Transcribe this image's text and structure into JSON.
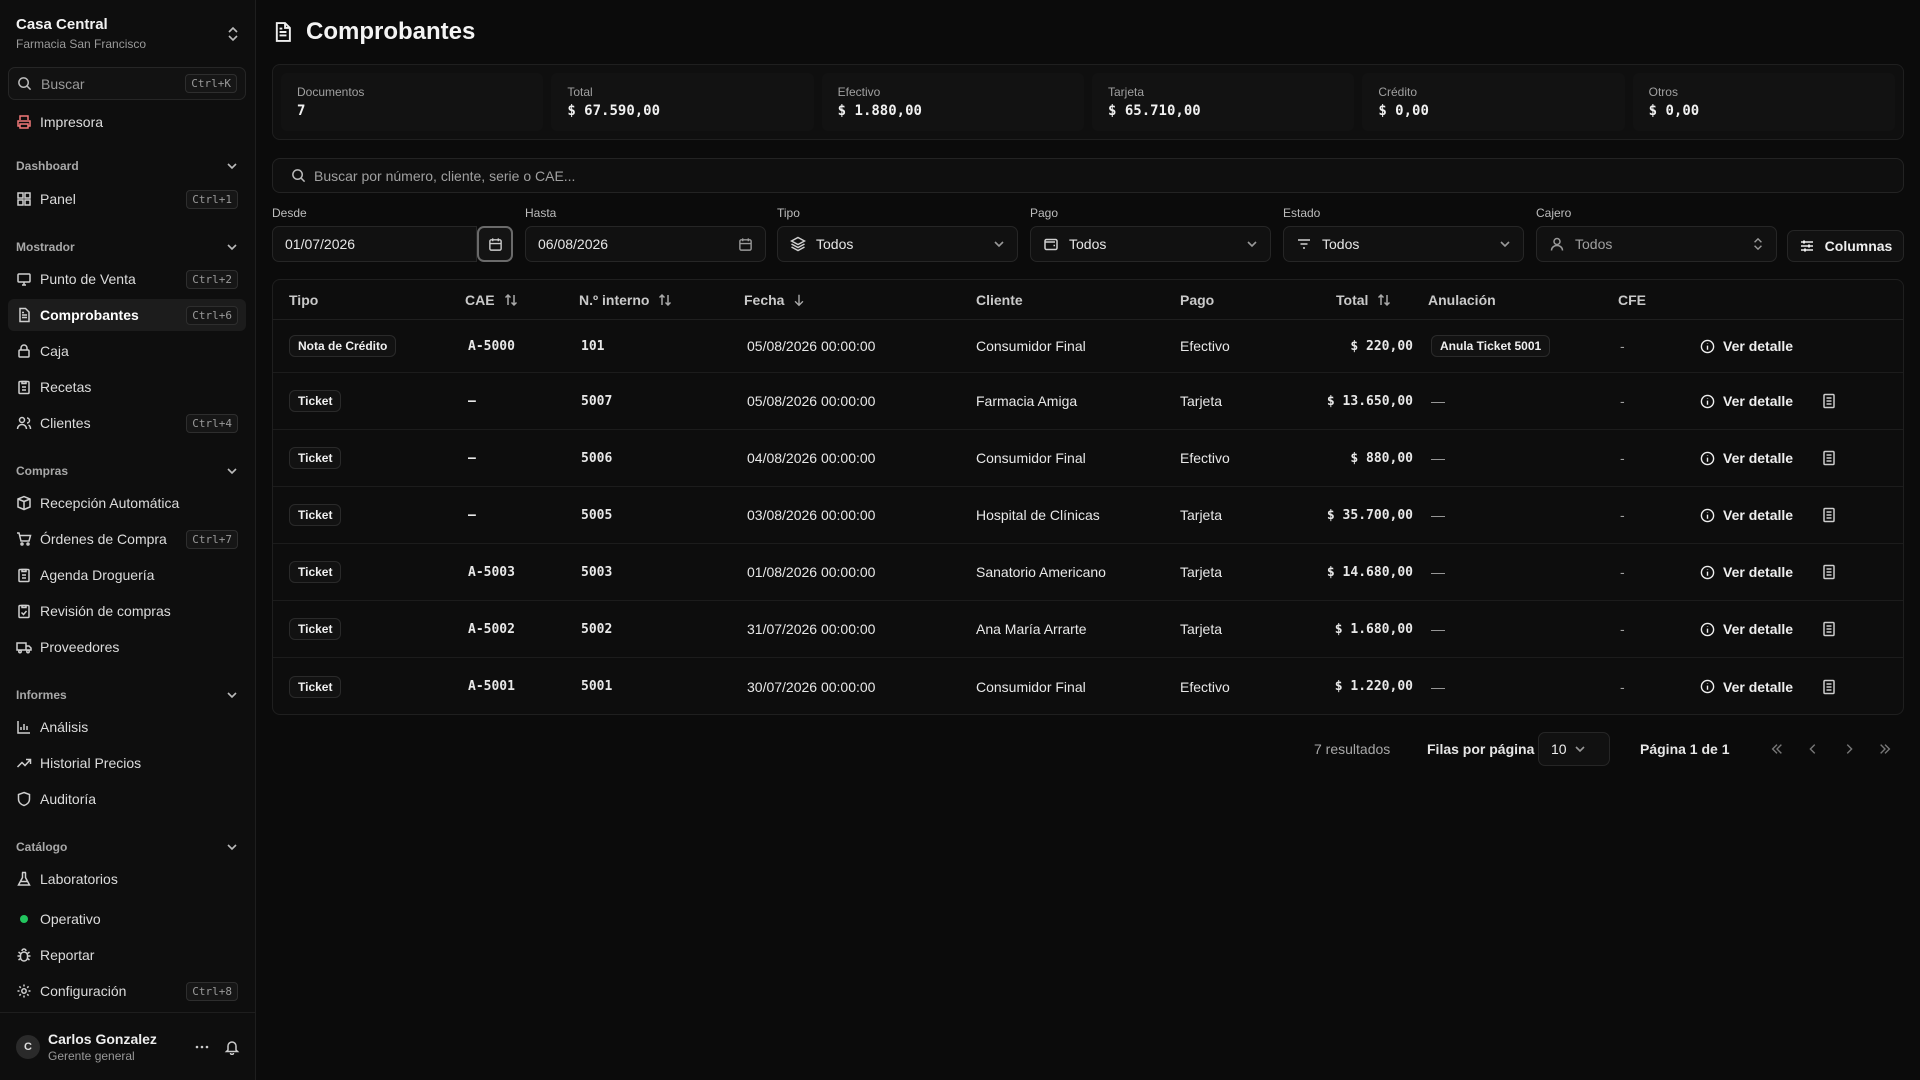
{
  "org": {
    "name": "Casa Central",
    "sub": "Farmacia San Francisco"
  },
  "sidebar": {
    "search": {
      "placeholder": "Buscar",
      "shortcut": "Ctrl+K"
    },
    "printer": "Impresora",
    "groups": {
      "dashboard": "Dashboard",
      "mostrador": "Mostrador",
      "compras": "Compras",
      "informes": "Informes",
      "catalogo": "Catálogo"
    },
    "items": {
      "panel": {
        "label": "Panel",
        "shortcut": "Ctrl+1"
      },
      "pos": {
        "label": "Punto de Venta",
        "shortcut": "Ctrl+2"
      },
      "comprobantes": {
        "label": "Comprobantes",
        "shortcut": "Ctrl+6"
      },
      "caja": {
        "label": "Caja"
      },
      "recetas": {
        "label": "Recetas"
      },
      "clientes": {
        "label": "Clientes",
        "shortcut": "Ctrl+4"
      },
      "recepcion": {
        "label": "Recepción Automática"
      },
      "ordenes": {
        "label": "Órdenes de Compra",
        "shortcut": "Ctrl+7"
      },
      "agenda": {
        "label": "Agenda Droguería"
      },
      "revision": {
        "label": "Revisión de compras"
      },
      "proveedores": {
        "label": "Proveedores"
      },
      "analisis": {
        "label": "Análisis"
      },
      "historial": {
        "label": "Historial Precios"
      },
      "auditoria": {
        "label": "Auditoría"
      },
      "laboratorios": {
        "label": "Laboratorios"
      },
      "operativo": {
        "label": "Operativo"
      },
      "reportar": {
        "label": "Reportar"
      },
      "config": {
        "label": "Configuración",
        "shortcut": "Ctrl+8"
      }
    },
    "user": {
      "initial": "C",
      "name": "Carlos Gonzalez",
      "role": "Gerente general"
    }
  },
  "page": {
    "title": "Comprobantes"
  },
  "stats": [
    {
      "label": "Documentos",
      "value": "7"
    },
    {
      "label": "Total",
      "value": "$ 67.590,00"
    },
    {
      "label": "Efectivo",
      "value": "$ 1.880,00"
    },
    {
      "label": "Tarjeta",
      "value": "$ 65.710,00"
    },
    {
      "label": "Crédito",
      "value": "$ 0,00"
    },
    {
      "label": "Otros",
      "value": "$ 0,00"
    }
  ],
  "search": {
    "placeholder": "Buscar por número, cliente, serie o CAE..."
  },
  "filters": {
    "desde": {
      "label": "Desde",
      "value": "01/07/2026"
    },
    "hasta": {
      "label": "Hasta",
      "value": "06/08/2026"
    },
    "tipo": {
      "label": "Tipo",
      "value": "Todos"
    },
    "pago": {
      "label": "Pago",
      "value": "Todos"
    },
    "estado": {
      "label": "Estado",
      "value": "Todos"
    },
    "cajero": {
      "label": "Cajero",
      "placeholder": "Todos"
    },
    "columns": "Columnas"
  },
  "table": {
    "headers": {
      "tipo": "Tipo",
      "cae": "CAE",
      "interno": "N.º interno",
      "fecha": "Fecha",
      "cliente": "Cliente",
      "pago": "Pago",
      "total": "Total",
      "anulacion": "Anulación",
      "cfe": "CFE"
    },
    "detail_label": "Ver detalle",
    "rows": [
      {
        "tipo": "Nota de Crédito",
        "cae": "A-5000",
        "interno": "101",
        "fecha": "05/08/2026 00:00:00",
        "cliente": "Consumidor Final",
        "pago": "Efectivo",
        "total": "$ 220,00",
        "anulacion": "Anula Ticket 5001",
        "cfe": "-"
      },
      {
        "tipo": "Ticket",
        "cae": "—",
        "interno": "5007",
        "fecha": "05/08/2026 00:00:00",
        "cliente": "Farmacia Amiga",
        "pago": "Tarjeta",
        "total": "$ 13.650,00",
        "anulacion": "—",
        "cfe": "-"
      },
      {
        "tipo": "Ticket",
        "cae": "—",
        "interno": "5006",
        "fecha": "04/08/2026 00:00:00",
        "cliente": "Consumidor Final",
        "pago": "Efectivo",
        "total": "$ 880,00",
        "anulacion": "—",
        "cfe": "-"
      },
      {
        "tipo": "Ticket",
        "cae": "—",
        "interno": "5005",
        "fecha": "03/08/2026 00:00:00",
        "cliente": "Hospital de Clínicas",
        "pago": "Tarjeta",
        "total": "$ 35.700,00",
        "anulacion": "—",
        "cfe": "-"
      },
      {
        "tipo": "Ticket",
        "cae": "A-5003",
        "interno": "5003",
        "fecha": "01/08/2026 00:00:00",
        "cliente": "Sanatorio Americano",
        "pago": "Tarjeta",
        "total": "$ 14.680,00",
        "anulacion": "—",
        "cfe": "-"
      },
      {
        "tipo": "Ticket",
        "cae": "A-5002",
        "interno": "5002",
        "fecha": "31/07/2026 00:00:00",
        "cliente": "Ana María Arrarte",
        "pago": "Tarjeta",
        "total": "$ 1.680,00",
        "anulacion": "—",
        "cfe": "-"
      },
      {
        "tipo": "Ticket",
        "cae": "A-5001",
        "interno": "5001",
        "fecha": "30/07/2026 00:00:00",
        "cliente": "Consumidor Final",
        "pago": "Efectivo",
        "total": "$ 1.220,00",
        "anulacion": "—",
        "cfe": "-"
      }
    ]
  },
  "pagination": {
    "results": "7 resultados",
    "rows_label": "Filas por página",
    "rows_value": "10",
    "page": "Página 1 de 1"
  }
}
